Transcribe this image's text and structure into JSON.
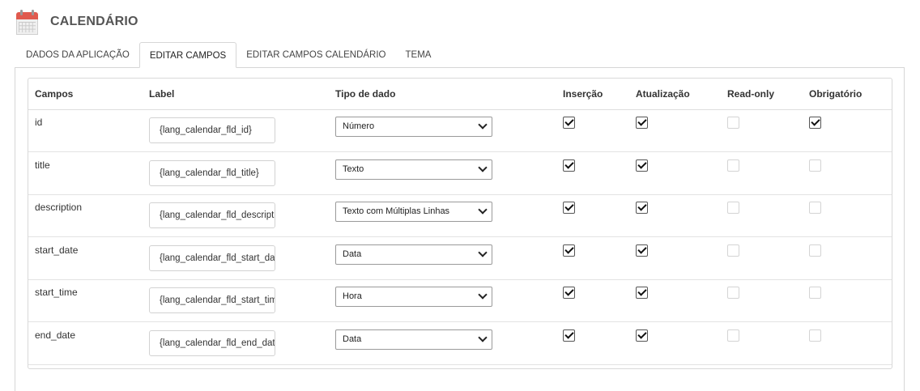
{
  "header": {
    "title": "CALENDÁRIO",
    "icon": "calendar-icon"
  },
  "tabs": [
    {
      "label": "DADOS DA APLICAÇÃO",
      "active": false
    },
    {
      "label": "EDITAR CAMPOS",
      "active": true
    },
    {
      "label": "EDITAR CAMPOS CALENDÁRIO",
      "active": false
    },
    {
      "label": "TEMA",
      "active": false
    }
  ],
  "table": {
    "columns": {
      "campos": "Campos",
      "label": "Label",
      "tipo": "Tipo de dado",
      "insercao": "Inserção",
      "atualizacao": "Atualização",
      "readonly": "Read-only",
      "obrigatorio": "Obrigatório"
    },
    "rows": [
      {
        "field": "id",
        "label": "{lang_calendar_fld_id}",
        "type": "Número",
        "insercao": true,
        "atualizacao": true,
        "readonly": false,
        "obrigatorio": true
      },
      {
        "field": "title",
        "label": "{lang_calendar_fld_title}",
        "type": "Texto",
        "insercao": true,
        "atualizacao": true,
        "readonly": false,
        "obrigatorio": false
      },
      {
        "field": "description",
        "label": "{lang_calendar_fld_description}",
        "type": "Texto com Múltiplas Linhas",
        "insercao": true,
        "atualizacao": true,
        "readonly": false,
        "obrigatorio": false
      },
      {
        "field": "start_date",
        "label": "{lang_calendar_fld_start_date}",
        "type": "Data",
        "insercao": true,
        "atualizacao": true,
        "readonly": false,
        "obrigatorio": false
      },
      {
        "field": "start_time",
        "label": "{lang_calendar_fld_start_time}",
        "type": "Hora",
        "insercao": true,
        "atualizacao": true,
        "readonly": false,
        "obrigatorio": false
      },
      {
        "field": "end_date",
        "label": "{lang_calendar_fld_end_date}",
        "type": "Data",
        "insercao": true,
        "atualizacao": true,
        "readonly": false,
        "obrigatorio": false
      }
    ]
  }
}
